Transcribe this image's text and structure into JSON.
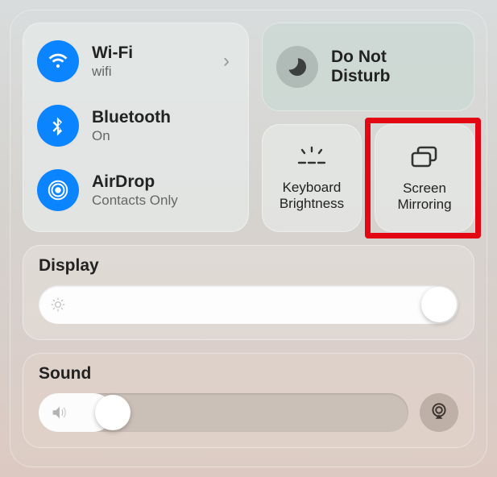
{
  "connectivity": {
    "wifi": {
      "title": "Wi-Fi",
      "sub": "wifi"
    },
    "bluetooth": {
      "title": "Bluetooth",
      "sub": "On"
    },
    "airdrop": {
      "title": "AirDrop",
      "sub": "Contacts Only"
    }
  },
  "dnd": {
    "line1": "Do Not",
    "line2": "Disturb"
  },
  "keyboard_brightness": {
    "line1": "Keyboard",
    "line2": "Brightness"
  },
  "screen_mirroring": {
    "line1": "Screen",
    "line2": "Mirroring"
  },
  "display": {
    "label": "Display",
    "value_percent": 100
  },
  "sound": {
    "label": "Sound",
    "value_percent": 20
  },
  "colors": {
    "accent": "#0b84ff",
    "highlight": "#e30613"
  }
}
